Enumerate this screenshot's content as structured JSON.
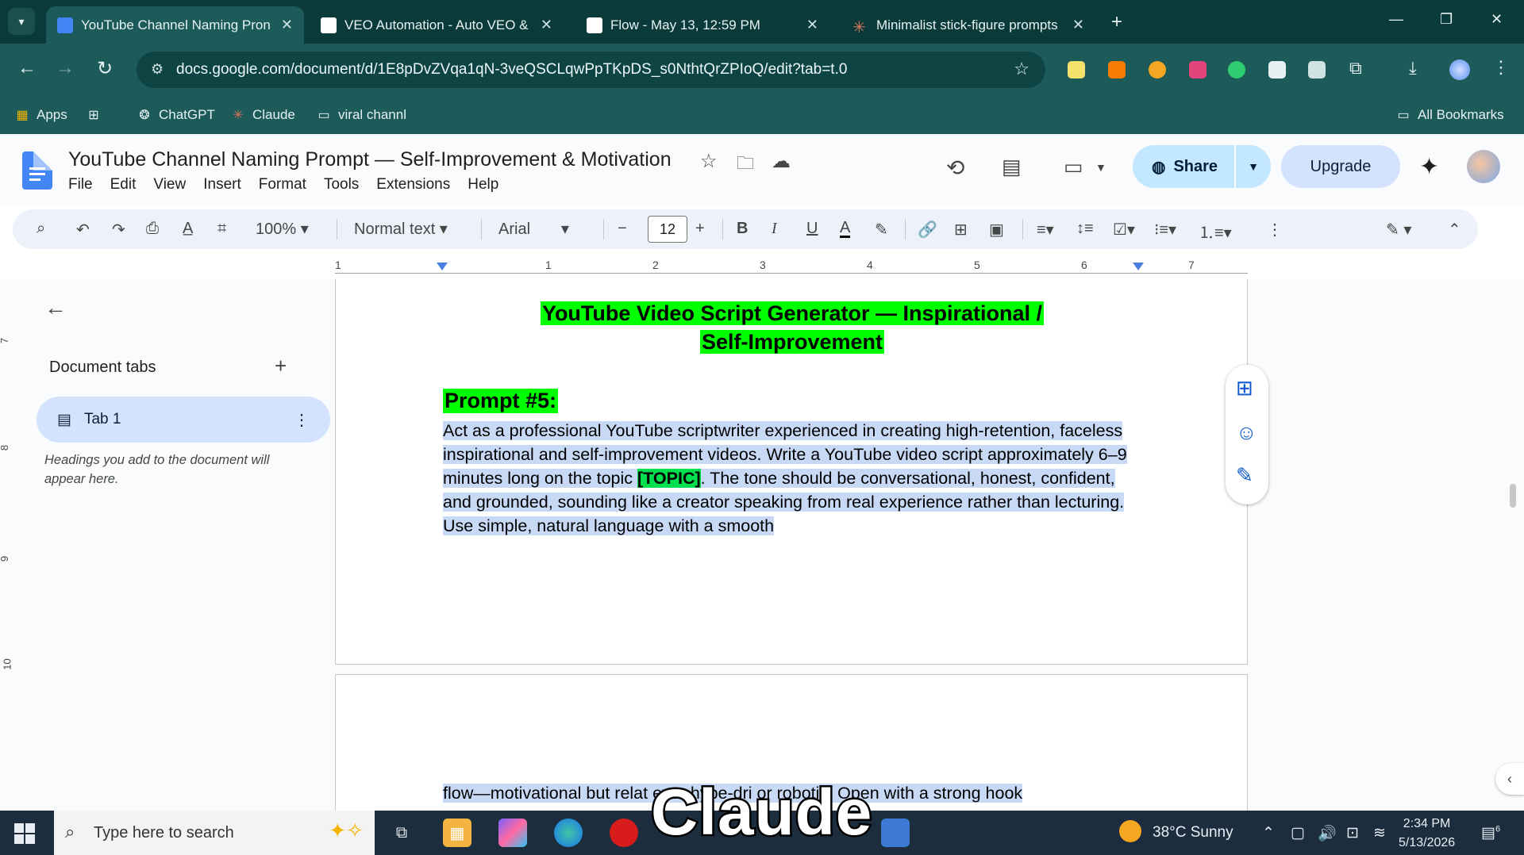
{
  "browser": {
    "tabs": [
      {
        "title": "YouTube Channel Naming Pron",
        "active": true,
        "color": "#4285f4"
      },
      {
        "title": "VEO Automation - Auto VEO &",
        "active": false,
        "color": "#ffffff"
      },
      {
        "title": "Flow - May 13, 12:59 PM",
        "active": false,
        "color": "#ffffff"
      },
      {
        "title": "Minimalist stick-figure prompts",
        "active": false,
        "color": "#d97757"
      }
    ],
    "url": "docs.google.com/document/d/1E8pDvZVqa1qN-3veQSCLqwPpTKpDS_s0NthtQrZPIoQ/edit?tab=t.0",
    "bookmarks": [
      {
        "label": "Apps",
        "icon": "apps-grid-icon"
      },
      {
        "label": "",
        "icon": "tab-groups-icon"
      },
      {
        "label": "ChatGPT",
        "icon": "chatgpt-icon"
      },
      {
        "label": "Claude",
        "icon": "claude-icon"
      },
      {
        "label": "viral channl",
        "icon": "folder-icon"
      }
    ],
    "all_bookmarks": "All Bookmarks"
  },
  "docs": {
    "title": "YouTube Channel Naming Prompt — Self-Improvement & Motivation",
    "menu": [
      "File",
      "Edit",
      "View",
      "Insert",
      "Format",
      "Tools",
      "Extensions",
      "Help"
    ],
    "share_label": "Share",
    "upgrade_label": "Upgrade",
    "toolbar": {
      "zoom": "100%",
      "style": "Normal text",
      "font": "Arial",
      "font_size": "12"
    },
    "ruler_numbers": [
      "1",
      "1",
      "2",
      "3",
      "4",
      "5",
      "6",
      "7"
    ],
    "vruler_numbers": [
      "7",
      "8",
      "9",
      "10"
    ]
  },
  "outline": {
    "heading": "Document tabs",
    "tab_label": "Tab 1",
    "hint": "Headings you add to the document will appear here."
  },
  "document": {
    "heading_line1": "YouTube Video Script Generator — Inspirational /",
    "heading_line2": "Self-Improvement",
    "prompt_heading": "Prompt #5:",
    "para_before": "Act as a professional YouTube scriptwriter experienced in creating high-retention, faceless inspirational and self-improvement videos. Write a YouTube video script approximately 6–9 minutes long on the topic ",
    "topic": "[TOPIC]",
    "para_after": ". The tone should be conversational, honest, confident, and grounded, sounding like a creator speaking from real experience rather than lecturing. Use simple, natural language with a smooth",
    "page2_text": "flow—motivational but relat      ever hype-dri    or robotic. Open with a strong hook"
  },
  "taskbar": {
    "search_placeholder": "Type here to search",
    "weather": "38°C  Sunny",
    "time": "2:34 PM",
    "date": "5/13/2026",
    "notif_count": "6"
  },
  "caption": "Claude",
  "colors": {
    "highlight_green": "#00ff00",
    "selection_blue": "#c7d9f5",
    "browser_teal": "#1d5a5a",
    "share_blue": "#c2e7ff"
  }
}
